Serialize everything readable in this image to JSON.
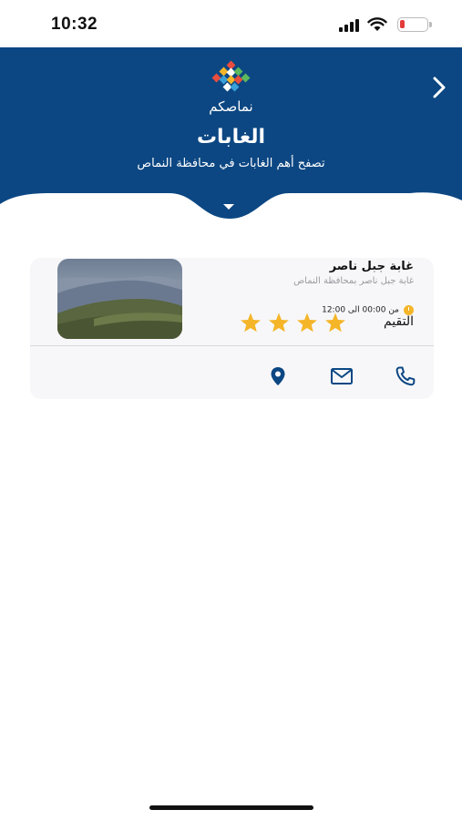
{
  "status_bar": {
    "time": "10:32",
    "battery_level": "19",
    "battery_color": "#e33b3b"
  },
  "header": {
    "logo_text": "نماصكم",
    "title": "الغابات",
    "subtitle": "تصفح أهم الغابات في محافظة النماص",
    "background_color": "#0c4783",
    "back_icon": "chevron-right-icon",
    "toggle_icon": "caret-down-icon"
  },
  "listing": {
    "name": "غابة جبل ناصر",
    "description": "غابة جبل ناصر بمحافظة النماص",
    "hours": "من 00:00 الى 12:00",
    "rating_label": "التقيم",
    "rating": 4,
    "rating_max": 4,
    "star_color": "#f5b528",
    "actions": [
      {
        "icon": "location-pin-icon"
      },
      {
        "icon": "mail-icon"
      },
      {
        "icon": "phone-icon"
      }
    ],
    "accent_color": "#0c4783"
  }
}
